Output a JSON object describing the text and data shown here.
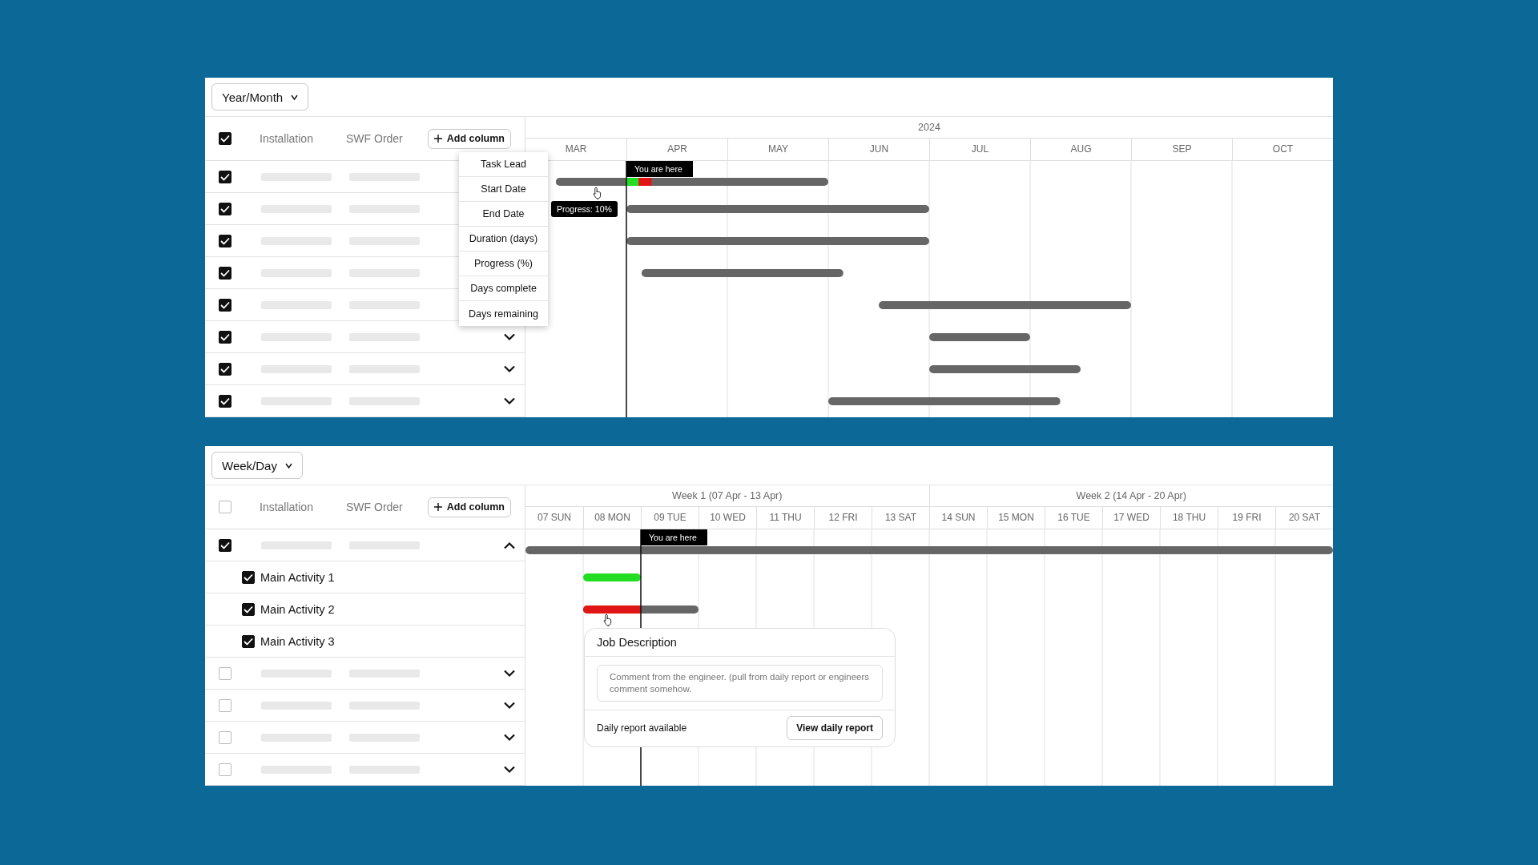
{
  "panels": [
    {
      "view_selector": "Year/Month",
      "header": {
        "checked": true,
        "columns": [
          "Installation",
          "SWF Order"
        ],
        "add_button": "Add column"
      },
      "rows": [
        {
          "checked": true
        },
        {
          "checked": true
        },
        {
          "checked": true
        },
        {
          "checked": true
        },
        {
          "checked": true
        },
        {
          "checked": true,
          "expanded": false
        },
        {
          "checked": true,
          "expanded": false
        },
        {
          "checked": true,
          "expanded": false
        }
      ],
      "column_menu": [
        "Task Lead",
        "Start Date",
        "End Date",
        "Duration (days)",
        "Progress (%)",
        "Days complete",
        "Days remaining"
      ],
      "timeline": {
        "header_groups": [
          "2024"
        ],
        "columns": [
          "MAR",
          "APR",
          "MAY",
          "JUN",
          "JUL",
          "AUG",
          "SEP",
          "OCT"
        ],
        "marker_label": "You are here",
        "tooltip": "Progress: 10%"
      }
    },
    {
      "view_selector": "Week/Day",
      "header": {
        "checked": false,
        "columns": [
          "Installation",
          "SWF Order"
        ],
        "add_button": "Add column"
      },
      "rows": [
        {
          "checked": true,
          "expanded": true,
          "children": [
            {
              "checked": true,
              "label": "Main Activity 1"
            },
            {
              "checked": true,
              "label": "Main Activity 2"
            },
            {
              "checked": true,
              "label": "Main Activity 3"
            }
          ]
        },
        {
          "checked": false,
          "expanded": false
        },
        {
          "checked": false,
          "expanded": false
        },
        {
          "checked": false,
          "expanded": false
        },
        {
          "checked": false,
          "expanded": false
        }
      ],
      "timeline": {
        "header_groups": [
          "Week 1 (07 Apr - 13 Apr)",
          "Week 2 (14 Apr - 20 Apr)"
        ],
        "columns": [
          "07 SUN",
          "08 MON",
          "09 TUE",
          "10 WED",
          "11 THU",
          "12 FRI",
          "13 SAT",
          "14 SUN",
          "15 MON",
          "16 TUE",
          "17 WED",
          "18 THU",
          "19 FRI",
          "20 SAT"
        ],
        "marker_label": "You are here",
        "popup": {
          "title": "Job Description",
          "comment": "Comment from the engineer. (pull from daily report or engineers comment somehow.",
          "footer_text": "Daily report available",
          "button": "View daily report"
        }
      }
    }
  ]
}
